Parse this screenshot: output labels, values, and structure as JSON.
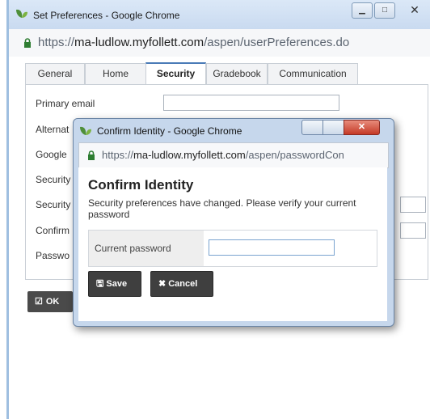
{
  "main_window": {
    "title": "Set Preferences - Google Chrome",
    "url_prefix": "https://",
    "url_host": "ma-ludlow.myfollett.com",
    "url_path": "/aspen/userPreferences.do"
  },
  "tabs": [
    {
      "label": "General"
    },
    {
      "label": "Home"
    },
    {
      "label": "Security",
      "active": true
    },
    {
      "label": "Gradebook"
    },
    {
      "label": "Communication"
    }
  ],
  "form": {
    "rows": [
      {
        "label": "Primary email"
      },
      {
        "label": "Alternat"
      },
      {
        "label": "Google"
      },
      {
        "label": "Security"
      },
      {
        "label": "Security"
      },
      {
        "label": "Confirm"
      },
      {
        "label": "Passwo"
      }
    ]
  },
  "ok_button": {
    "label": "OK",
    "icon": "check-square-icon"
  },
  "dialog": {
    "title": "Confirm Identity - Google Chrome",
    "url_prefix": "https://",
    "url_host": "ma-ludlow.myfollett.com",
    "url_path": "/aspen/passwordCon",
    "heading": "Confirm Identity",
    "message": "Security preferences have changed. Please verify your current password",
    "field_label": "Current password",
    "field_value": "",
    "save_label": "Save",
    "cancel_label": "Cancel"
  },
  "colors": {
    "titlebar": "#c9daf0",
    "button_dark": "#3f3f3f",
    "tab_accent": "#4a7bb7",
    "close_red": "#c43a27"
  }
}
